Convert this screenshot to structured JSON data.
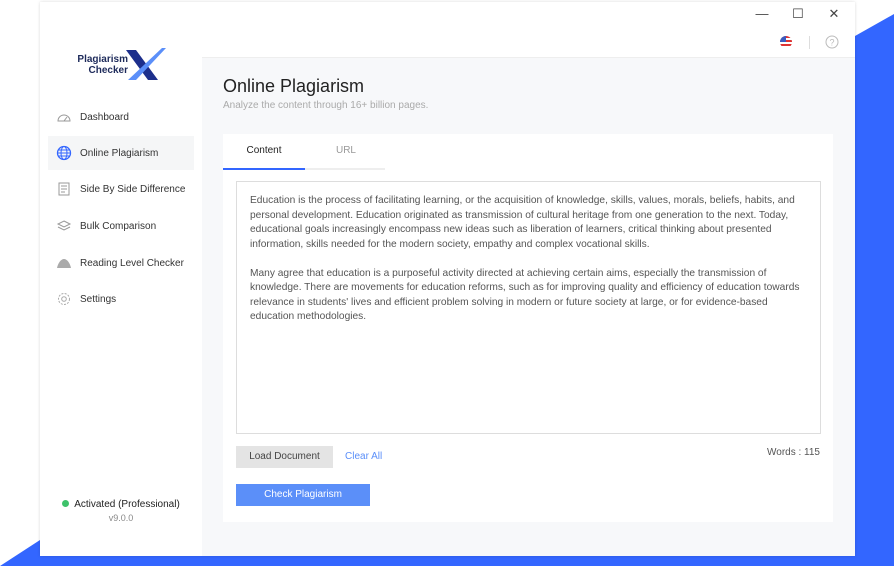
{
  "colors": {
    "accent": "#3366ff",
    "button": "#5b8ff9",
    "active_dot": "#3ec26b"
  },
  "logo": {
    "line1": "Plagiarism",
    "line2": "Checker",
    "mark": "X"
  },
  "window_controls": {
    "minimize": "—",
    "maximize": "☐",
    "close": "✕"
  },
  "header": {
    "flag_icon": "us-flag-icon",
    "help_icon": "help-circle-icon"
  },
  "sidebar": {
    "items": [
      {
        "label": "Dashboard",
        "icon": "gauge-icon"
      },
      {
        "label": "Online Plagiarism",
        "icon": "globe-icon",
        "active": true
      },
      {
        "label": "Side By Side Difference",
        "icon": "document-icon"
      },
      {
        "label": "Bulk Comparison",
        "icon": "layers-icon"
      },
      {
        "label": "Reading Level Checker",
        "icon": "cloud-icon"
      },
      {
        "label": "Settings",
        "icon": "gear-icon"
      }
    ],
    "status": "Activated (Professional)",
    "version": "v9.0.0"
  },
  "main": {
    "title": "Online Plagiarism",
    "subtitle": "Analyze the content through 16+ billion pages.",
    "tabs": [
      {
        "label": "Content"
      },
      {
        "label": "URL"
      }
    ],
    "content": [
      "Education is the process of facilitating learning, or the acquisition of knowledge, skills, values, morals, beliefs, habits, and personal development. Education originated as transmission of cultural heritage from one generation to the next. Today, educational goals increasingly encompass new ideas such as liberation of learners, critical thinking about presented information, skills needed for the modern society, empathy and complex vocational skills.",
      "Many agree that education is a purposeful activity directed at achieving certain aims, especially the transmission of knowledge. There are movements for education reforms, such as for improving quality and efficiency of education towards relevance in students' lives and efficient problem solving in modern or future society at large, or for evidence-based education methodologies."
    ],
    "load_document": "Load Document",
    "clear_all": "Clear All",
    "words": "Words : 115",
    "check": "Check Plagiarism"
  }
}
